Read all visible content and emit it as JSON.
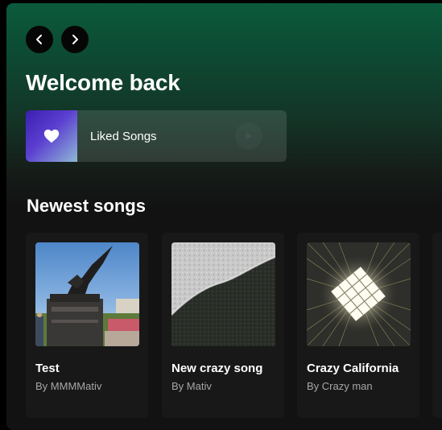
{
  "header": {
    "back_icon": "chevron-left-icon",
    "forward_icon": "chevron-right-icon",
    "title": "Welcome back"
  },
  "liked": {
    "label": "Liked Songs",
    "icon": "heart-icon",
    "play_icon": "play-icon"
  },
  "section": {
    "title": "Newest songs"
  },
  "songs": [
    {
      "title": "Test",
      "artist": "By MMMMativ",
      "art": "statue-photo"
    },
    {
      "title": "New crazy song",
      "artist": "By Mativ",
      "art": "beach-water-photo"
    },
    {
      "title": "Crazy California",
      "artist": "By Crazy man",
      "art": "light-cube-abstract"
    }
  ],
  "colors": {
    "accent_green": "#0b5a3c",
    "background": "#121212",
    "card": "#181818",
    "liked_gradient_start": "#3b1fb2",
    "liked_gradient_end": "#8fb8d6",
    "muted_text": "#a7a7a7"
  }
}
